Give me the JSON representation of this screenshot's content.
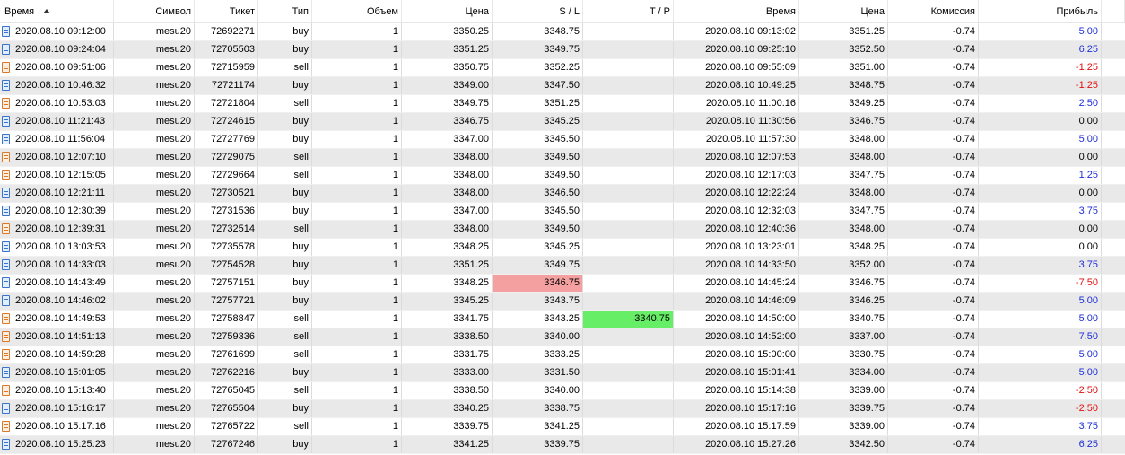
{
  "columns": {
    "time": "Время",
    "symbol": "Символ",
    "ticket": "Тикет",
    "type": "Тип",
    "volume": "Объем",
    "price": "Цена",
    "sl": "S / L",
    "tp": "T / P",
    "close_time": "Время",
    "close_price": "Цена",
    "commission": "Комиссия",
    "profit": "Прибыль"
  },
  "colors": {
    "profit_positive": "#1f2fd6",
    "profit_negative": "#e01010",
    "sl_highlight": "#f5a0a0",
    "tp_highlight": "#66ee66",
    "buy_icon": "#3b73c9",
    "sell_icon": "#d9792c",
    "alt_row": "#e9e9e9"
  },
  "rows": [
    {
      "time": "2020.08.10 09:12:00",
      "symbol": "mesu20",
      "ticket": "72692271",
      "type": "buy",
      "volume": "1",
      "price": "3350.25",
      "sl": "3348.75",
      "tp": "",
      "close_time": "2020.08.10 09:13:02",
      "close_price": "3351.25",
      "commission": "-0.74",
      "profit": "5.00",
      "hl": ""
    },
    {
      "time": "2020.08.10 09:24:04",
      "symbol": "mesu20",
      "ticket": "72705503",
      "type": "buy",
      "volume": "1",
      "price": "3351.25",
      "sl": "3349.75",
      "tp": "",
      "close_time": "2020.08.10 09:25:10",
      "close_price": "3352.50",
      "commission": "-0.74",
      "profit": "6.25",
      "hl": ""
    },
    {
      "time": "2020.08.10 09:51:06",
      "symbol": "mesu20",
      "ticket": "72715959",
      "type": "sell",
      "volume": "1",
      "price": "3350.75",
      "sl": "3352.25",
      "tp": "",
      "close_time": "2020.08.10 09:55:09",
      "close_price": "3351.00",
      "commission": "-0.74",
      "profit": "-1.25",
      "hl": ""
    },
    {
      "time": "2020.08.10 10:46:32",
      "symbol": "mesu20",
      "ticket": "72721174",
      "type": "buy",
      "volume": "1",
      "price": "3349.00",
      "sl": "3347.50",
      "tp": "",
      "close_time": "2020.08.10 10:49:25",
      "close_price": "3348.75",
      "commission": "-0.74",
      "profit": "-1.25",
      "hl": ""
    },
    {
      "time": "2020.08.10 10:53:03",
      "symbol": "mesu20",
      "ticket": "72721804",
      "type": "sell",
      "volume": "1",
      "price": "3349.75",
      "sl": "3351.25",
      "tp": "",
      "close_time": "2020.08.10 11:00:16",
      "close_price": "3349.25",
      "commission": "-0.74",
      "profit": "2.50",
      "hl": ""
    },
    {
      "time": "2020.08.10 11:21:43",
      "symbol": "mesu20",
      "ticket": "72724615",
      "type": "buy",
      "volume": "1",
      "price": "3346.75",
      "sl": "3345.25",
      "tp": "",
      "close_time": "2020.08.10 11:30:56",
      "close_price": "3346.75",
      "commission": "-0.74",
      "profit": "0.00",
      "hl": ""
    },
    {
      "time": "2020.08.10 11:56:04",
      "symbol": "mesu20",
      "ticket": "72727769",
      "type": "buy",
      "volume": "1",
      "price": "3347.00",
      "sl": "3345.50",
      "tp": "",
      "close_time": "2020.08.10 11:57:30",
      "close_price": "3348.00",
      "commission": "-0.74",
      "profit": "5.00",
      "hl": ""
    },
    {
      "time": "2020.08.10 12:07:10",
      "symbol": "mesu20",
      "ticket": "72729075",
      "type": "sell",
      "volume": "1",
      "price": "3348.00",
      "sl": "3349.50",
      "tp": "",
      "close_time": "2020.08.10 12:07:53",
      "close_price": "3348.00",
      "commission": "-0.74",
      "profit": "0.00",
      "hl": ""
    },
    {
      "time": "2020.08.10 12:15:05",
      "symbol": "mesu20",
      "ticket": "72729664",
      "type": "sell",
      "volume": "1",
      "price": "3348.00",
      "sl": "3349.50",
      "tp": "",
      "close_time": "2020.08.10 12:17:03",
      "close_price": "3347.75",
      "commission": "-0.74",
      "profit": "1.25",
      "hl": ""
    },
    {
      "time": "2020.08.10 12:21:11",
      "symbol": "mesu20",
      "ticket": "72730521",
      "type": "buy",
      "volume": "1",
      "price": "3348.00",
      "sl": "3346.50",
      "tp": "",
      "close_time": "2020.08.10 12:22:24",
      "close_price": "3348.00",
      "commission": "-0.74",
      "profit": "0.00",
      "hl": ""
    },
    {
      "time": "2020.08.10 12:30:39",
      "symbol": "mesu20",
      "ticket": "72731536",
      "type": "buy",
      "volume": "1",
      "price": "3347.00",
      "sl": "3345.50",
      "tp": "",
      "close_time": "2020.08.10 12:32:03",
      "close_price": "3347.75",
      "commission": "-0.74",
      "profit": "3.75",
      "hl": ""
    },
    {
      "time": "2020.08.10 12:39:31",
      "symbol": "mesu20",
      "ticket": "72732514",
      "type": "sell",
      "volume": "1",
      "price": "3348.00",
      "sl": "3349.50",
      "tp": "",
      "close_time": "2020.08.10 12:40:36",
      "close_price": "3348.00",
      "commission": "-0.74",
      "profit": "0.00",
      "hl": ""
    },
    {
      "time": "2020.08.10 13:03:53",
      "symbol": "mesu20",
      "ticket": "72735578",
      "type": "buy",
      "volume": "1",
      "price": "3348.25",
      "sl": "3345.25",
      "tp": "",
      "close_time": "2020.08.10 13:23:01",
      "close_price": "3348.25",
      "commission": "-0.74",
      "profit": "0.00",
      "hl": ""
    },
    {
      "time": "2020.08.10 14:33:03",
      "symbol": "mesu20",
      "ticket": "72754528",
      "type": "buy",
      "volume": "1",
      "price": "3351.25",
      "sl": "3349.75",
      "tp": "",
      "close_time": "2020.08.10 14:33:50",
      "close_price": "3352.00",
      "commission": "-0.74",
      "profit": "3.75",
      "hl": ""
    },
    {
      "time": "2020.08.10 14:43:49",
      "symbol": "mesu20",
      "ticket": "72757151",
      "type": "buy",
      "volume": "1",
      "price": "3348.25",
      "sl": "3346.75",
      "tp": "",
      "close_time": "2020.08.10 14:45:24",
      "close_price": "3346.75",
      "commission": "-0.74",
      "profit": "-7.50",
      "hl": "sl"
    },
    {
      "time": "2020.08.10 14:46:02",
      "symbol": "mesu20",
      "ticket": "72757721",
      "type": "buy",
      "volume": "1",
      "price": "3345.25",
      "sl": "3343.75",
      "tp": "",
      "close_time": "2020.08.10 14:46:09",
      "close_price": "3346.25",
      "commission": "-0.74",
      "profit": "5.00",
      "hl": ""
    },
    {
      "time": "2020.08.10 14:49:53",
      "symbol": "mesu20",
      "ticket": "72758847",
      "type": "sell",
      "volume": "1",
      "price": "3341.75",
      "sl": "3343.25",
      "tp": "3340.75",
      "close_time": "2020.08.10 14:50:00",
      "close_price": "3340.75",
      "commission": "-0.74",
      "profit": "5.00",
      "hl": "tp"
    },
    {
      "time": "2020.08.10 14:51:13",
      "symbol": "mesu20",
      "ticket": "72759336",
      "type": "sell",
      "volume": "1",
      "price": "3338.50",
      "sl": "3340.00",
      "tp": "",
      "close_time": "2020.08.10 14:52:00",
      "close_price": "3337.00",
      "commission": "-0.74",
      "profit": "7.50",
      "hl": ""
    },
    {
      "time": "2020.08.10 14:59:28",
      "symbol": "mesu20",
      "ticket": "72761699",
      "type": "sell",
      "volume": "1",
      "price": "3331.75",
      "sl": "3333.25",
      "tp": "",
      "close_time": "2020.08.10 15:00:00",
      "close_price": "3330.75",
      "commission": "-0.74",
      "profit": "5.00",
      "hl": ""
    },
    {
      "time": "2020.08.10 15:01:05",
      "symbol": "mesu20",
      "ticket": "72762216",
      "type": "buy",
      "volume": "1",
      "price": "3333.00",
      "sl": "3331.50",
      "tp": "",
      "close_time": "2020.08.10 15:01:41",
      "close_price": "3334.00",
      "commission": "-0.74",
      "profit": "5.00",
      "hl": ""
    },
    {
      "time": "2020.08.10 15:13:40",
      "symbol": "mesu20",
      "ticket": "72765045",
      "type": "sell",
      "volume": "1",
      "price": "3338.50",
      "sl": "3340.00",
      "tp": "",
      "close_time": "2020.08.10 15:14:38",
      "close_price": "3339.00",
      "commission": "-0.74",
      "profit": "-2.50",
      "hl": ""
    },
    {
      "time": "2020.08.10 15:16:17",
      "symbol": "mesu20",
      "ticket": "72765504",
      "type": "buy",
      "volume": "1",
      "price": "3340.25",
      "sl": "3338.75",
      "tp": "",
      "close_time": "2020.08.10 15:17:16",
      "close_price": "3339.75",
      "commission": "-0.74",
      "profit": "-2.50",
      "hl": ""
    },
    {
      "time": "2020.08.10 15:17:16",
      "symbol": "mesu20",
      "ticket": "72765722",
      "type": "sell",
      "volume": "1",
      "price": "3339.75",
      "sl": "3341.25",
      "tp": "",
      "close_time": "2020.08.10 15:17:59",
      "close_price": "3339.00",
      "commission": "-0.74",
      "profit": "3.75",
      "hl": ""
    },
    {
      "time": "2020.08.10 15:25:23",
      "symbol": "mesu20",
      "ticket": "72767246",
      "type": "buy",
      "volume": "1",
      "price": "3341.25",
      "sl": "3339.75",
      "tp": "",
      "close_time": "2020.08.10 15:27:26",
      "close_price": "3342.50",
      "commission": "-0.74",
      "profit": "6.25",
      "hl": ""
    }
  ]
}
